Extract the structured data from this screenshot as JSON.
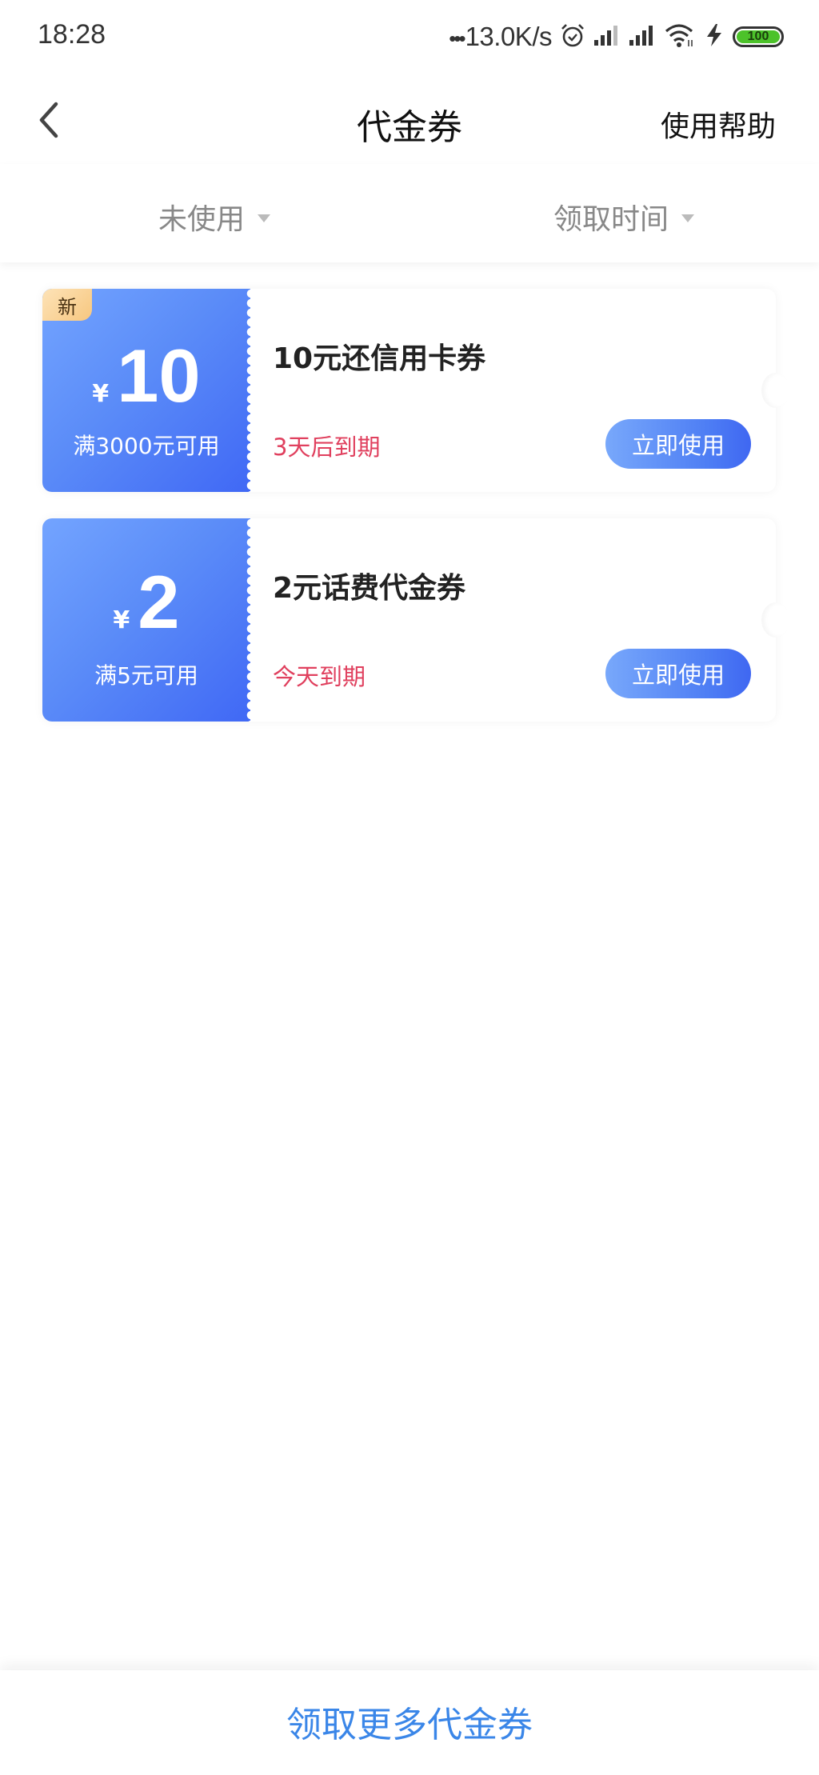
{
  "status_bar": {
    "time": "18:28",
    "net_dots": "•••",
    "net_speed": "13.0K/s",
    "icons": [
      "alarm-icon",
      "signal-icon",
      "signal-icon",
      "wifi-icon",
      "charging-icon",
      "battery-icon"
    ],
    "battery_level": "100",
    "battery_color": "#4cc22a"
  },
  "nav": {
    "back_icon": "chevron-left-icon",
    "title": "代金券",
    "help_label": "使用帮助"
  },
  "filters": {
    "status_label": "未使用",
    "sort_label": "领取时间",
    "dropdown_icon": "triangle-down-icon"
  },
  "coupons": [
    {
      "is_new": true,
      "new_label": "新",
      "currency": "¥",
      "amount": "10",
      "threshold": "满3000元可用",
      "title": "10元还信用卡券",
      "expiry": "3天后到期",
      "action_label": "立即使用"
    },
    {
      "is_new": false,
      "currency": "¥",
      "amount": "2",
      "threshold": "满5元可用",
      "title": "2元话费代金券",
      "expiry": "今天到期",
      "action_label": "立即使用"
    }
  ],
  "footer": {
    "link_label": "领取更多代金券"
  },
  "colors": {
    "accent_blue": "#4e7ef4",
    "expiry_red": "#e0405e",
    "footer_link": "#3a86e8",
    "badge_gold": "#f7c77f"
  }
}
